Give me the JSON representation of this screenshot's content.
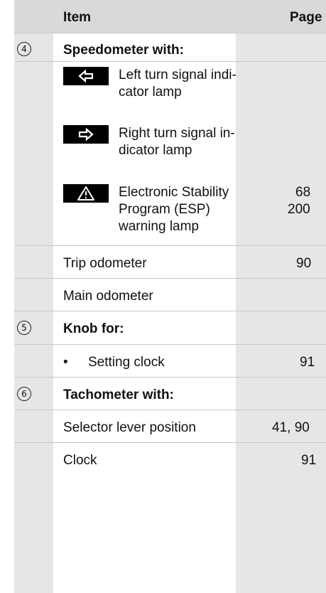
{
  "header": {
    "item": "Item",
    "page": "Page"
  },
  "rows": {
    "r4_num": "4",
    "r4_title": "Speedometer with:",
    "left_line1": "Left turn signal indi-",
    "left_line2": "cator lamp",
    "right_line1": "Right turn signal in-",
    "right_line2": "dicator lamp",
    "esp_line1": "Electronic Stability",
    "esp_line2": "Program (ESP)",
    "esp_line3": "warning lamp",
    "esp_page1": "68",
    "esp_page2": "200",
    "trip": "Trip odometer",
    "trip_page": "90",
    "main_odo": "Main odometer",
    "r5_num": "5",
    "r5_title": "Knob for:",
    "clock_bullet": "•",
    "clock_set": "Setting clock",
    "clock_set_page": "91",
    "r6_num": "6",
    "r6_title": "Tachometer with:",
    "selector": "Selector lever position",
    "selector_page": "41, 90",
    "clock": "Clock",
    "clock_page": "91"
  },
  "icons": {
    "left": "left-turn-arrow-icon",
    "right": "right-turn-arrow-icon",
    "esp": "warning-triangle-icon"
  }
}
